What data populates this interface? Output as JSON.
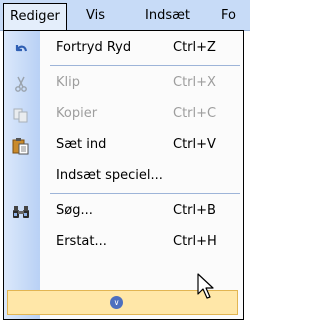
{
  "menubar": {
    "items": [
      "Rediger",
      "Vis",
      "Indsæt",
      "Fo"
    ]
  },
  "menu": {
    "items": [
      {
        "label": "Fortryd Ryd",
        "shortcut": "Ctrl+Z",
        "icon": "undo-icon",
        "enabled": true
      },
      {
        "label": "Klip",
        "shortcut": "Ctrl+X",
        "icon": "cut-icon",
        "enabled": false
      },
      {
        "label": "Kopier",
        "shortcut": "Ctrl+C",
        "icon": "copy-icon",
        "enabled": false
      },
      {
        "label": "Sæt ind",
        "shortcut": "Ctrl+V",
        "icon": "paste-icon",
        "enabled": true
      },
      {
        "label": "Indsæt speciel...",
        "shortcut": "",
        "icon": "",
        "enabled": true
      },
      {
        "label": "Søg...",
        "shortcut": "Ctrl+B",
        "icon": "binoculars-icon",
        "enabled": true
      },
      {
        "label": "Erstat...",
        "shortcut": "Ctrl+H",
        "icon": "",
        "enabled": true
      }
    ],
    "expand_icon": "double-chevron-down-icon"
  },
  "colors": {
    "menubar_bg": "#c7dbf7",
    "gutter_start": "#dbe8fb",
    "gutter_end": "#b9d1f5",
    "expand_bg": "#ffe7a8",
    "disabled_text": "#9d9d9d"
  }
}
